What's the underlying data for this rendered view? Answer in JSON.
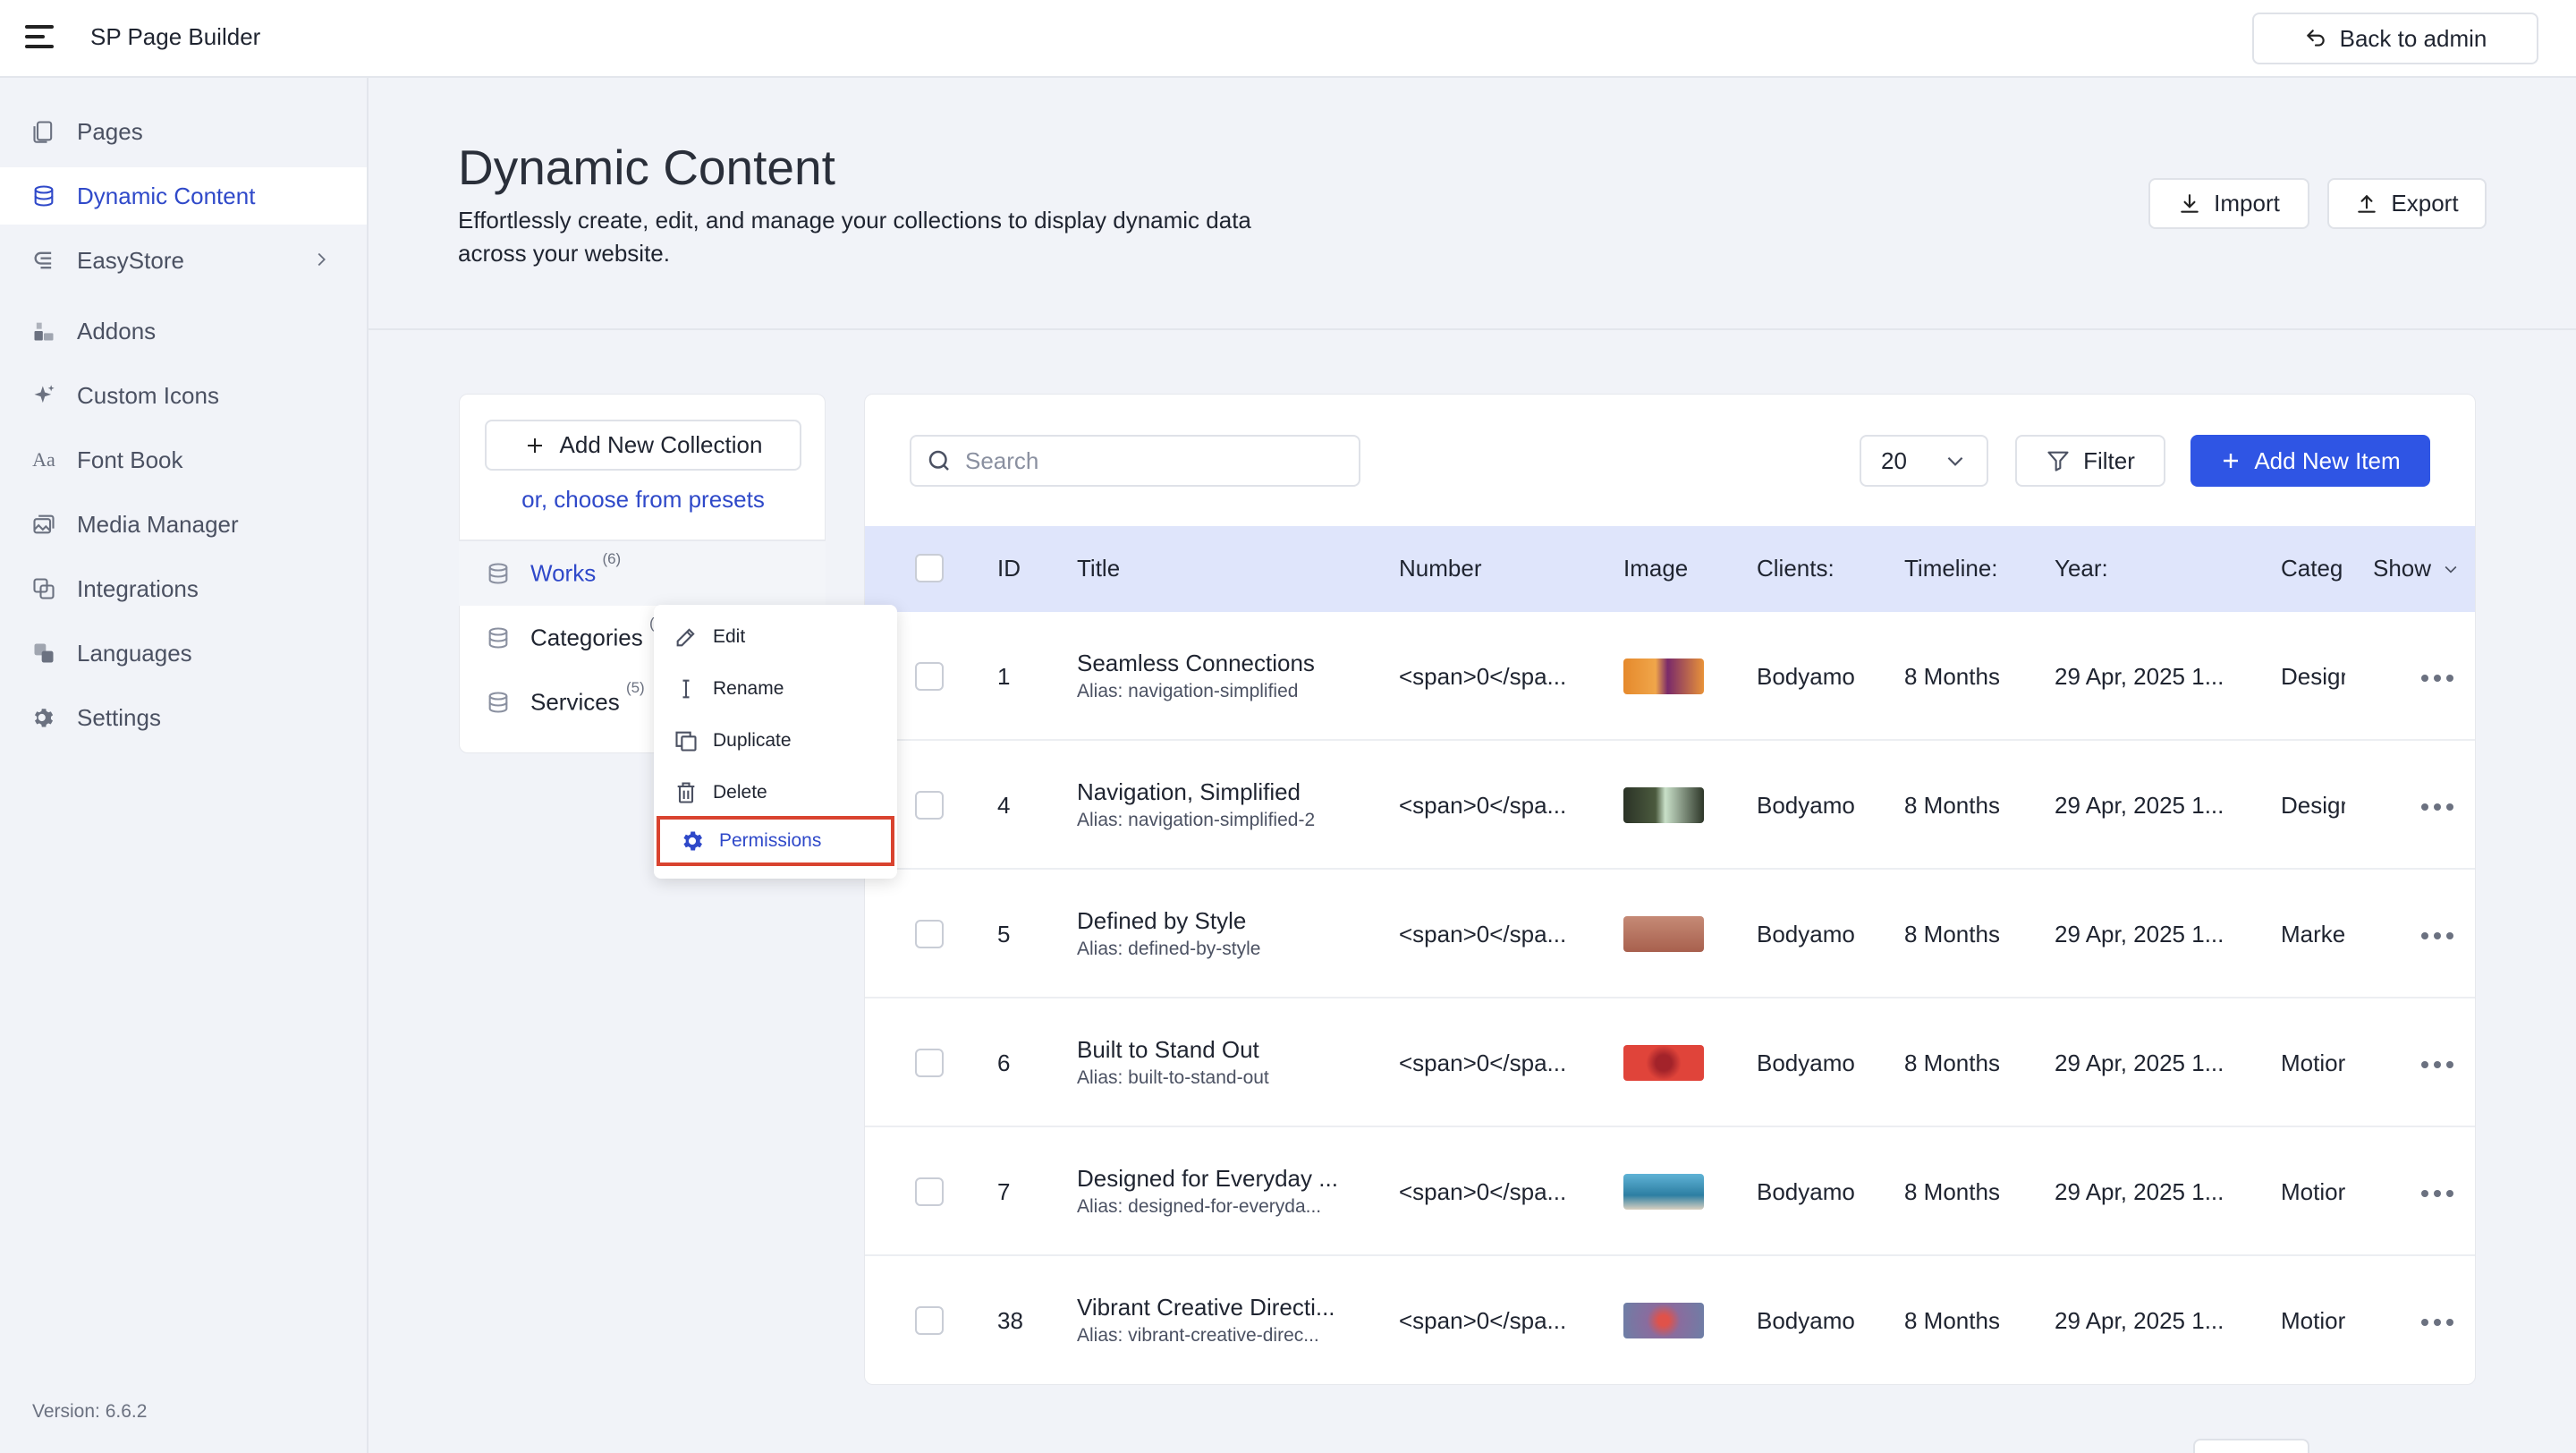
{
  "app": {
    "brand": "SP Page Builder",
    "back_label": "Back to admin",
    "version": "Version: 6.6.2"
  },
  "sidebar": {
    "items": [
      {
        "label": "Pages",
        "icon": "pages-icon"
      },
      {
        "label": "Dynamic Content",
        "icon": "database-icon",
        "active": true
      },
      {
        "label": "EasyStore",
        "icon": "store-icon",
        "has_submenu": true
      },
      {
        "label": "Addons",
        "icon": "addons-icon"
      },
      {
        "label": "Custom Icons",
        "icon": "sparkle-icon"
      },
      {
        "label": "Font Book",
        "icon": "font-icon"
      },
      {
        "label": "Media Manager",
        "icon": "media-icon"
      },
      {
        "label": "Integrations",
        "icon": "integrations-icon"
      },
      {
        "label": "Languages",
        "icon": "languages-icon"
      },
      {
        "label": "Settings",
        "icon": "gear-icon"
      }
    ]
  },
  "header": {
    "title": "Dynamic Content",
    "description": "Effortlessly create, edit, and manage your collections to display dynamic data across your website.",
    "import_label": "Import",
    "export_label": "Export"
  },
  "collections": {
    "add_label": "Add New Collection",
    "presets_label": "or, choose from presets",
    "items": [
      {
        "name": "Works",
        "count": "(6)",
        "active": true
      },
      {
        "name": "Categories",
        "count": "("
      },
      {
        "name": "Services",
        "count": "(5)"
      }
    ]
  },
  "context_menu": {
    "items": [
      {
        "label": "Edit",
        "icon": "edit-icon"
      },
      {
        "label": "Rename",
        "icon": "rename-icon"
      },
      {
        "label": "Duplicate",
        "icon": "duplicate-icon"
      },
      {
        "label": "Delete",
        "icon": "trash-icon"
      },
      {
        "label": "Permissions",
        "icon": "gear-icon",
        "highlighted": true
      }
    ]
  },
  "toolbar": {
    "search_placeholder": "Search",
    "per_page": "20",
    "filter_label": "Filter",
    "add_item_label": "Add New Item"
  },
  "table": {
    "columns": [
      "ID",
      "Title",
      "Number",
      "Image",
      "Clients:",
      "Timeline:",
      "Year:",
      "Categ",
      "Show"
    ],
    "rows": [
      {
        "id": "1",
        "title": "Seamless Connections",
        "alias": "Alias: navigation-simplified",
        "number": "<span>0</spa...",
        "client": "Bodyamo",
        "timeline": "8 Months",
        "year": "29 Apr, 2025 1...",
        "category": "Desigr",
        "thumb_color": "#e38a2e"
      },
      {
        "id": "4",
        "title": "Navigation, Simplified",
        "alias": "Alias: navigation-simplified-2",
        "number": "<span>0</spa...",
        "client": "Bodyamo",
        "timeline": "8 Months",
        "year": "29 Apr, 2025 1...",
        "category": "Desigr",
        "thumb_color": "#2f3a2c"
      },
      {
        "id": "5",
        "title": "Defined by Style",
        "alias": "Alias: defined-by-style",
        "number": "<span>0</spa...",
        "client": "Bodyamo",
        "timeline": "8 Months",
        "year": "29 Apr, 2025 1...",
        "category": "Marke",
        "thumb_color": "#b9705a"
      },
      {
        "id": "6",
        "title": "Built to Stand Out",
        "alias": "Alias: built-to-stand-out",
        "number": "<span>0</spa...",
        "client": "Bodyamo",
        "timeline": "8 Months",
        "year": "29 Apr, 2025 1...",
        "category": "Motior",
        "thumb_color": "#e0443a"
      },
      {
        "id": "7",
        "title": "Designed for Everyday ...",
        "alias": "Alias: designed-for-everyda...",
        "number": "<span>0</spa...",
        "client": "Bodyamo",
        "timeline": "8 Months",
        "year": "29 Apr, 2025 1...",
        "category": "Motior",
        "thumb_color": "#3a8fb5"
      },
      {
        "id": "38",
        "title": "Vibrant Creative Directi...",
        "alias": "Alias: vibrant-creative-direc...",
        "number": "<span>0</spa...",
        "client": "Bodyamo",
        "timeline": "8 Months",
        "year": "29 Apr, 2025 1...",
        "category": "Motior",
        "thumb_color": "#8a6c9e"
      }
    ]
  }
}
